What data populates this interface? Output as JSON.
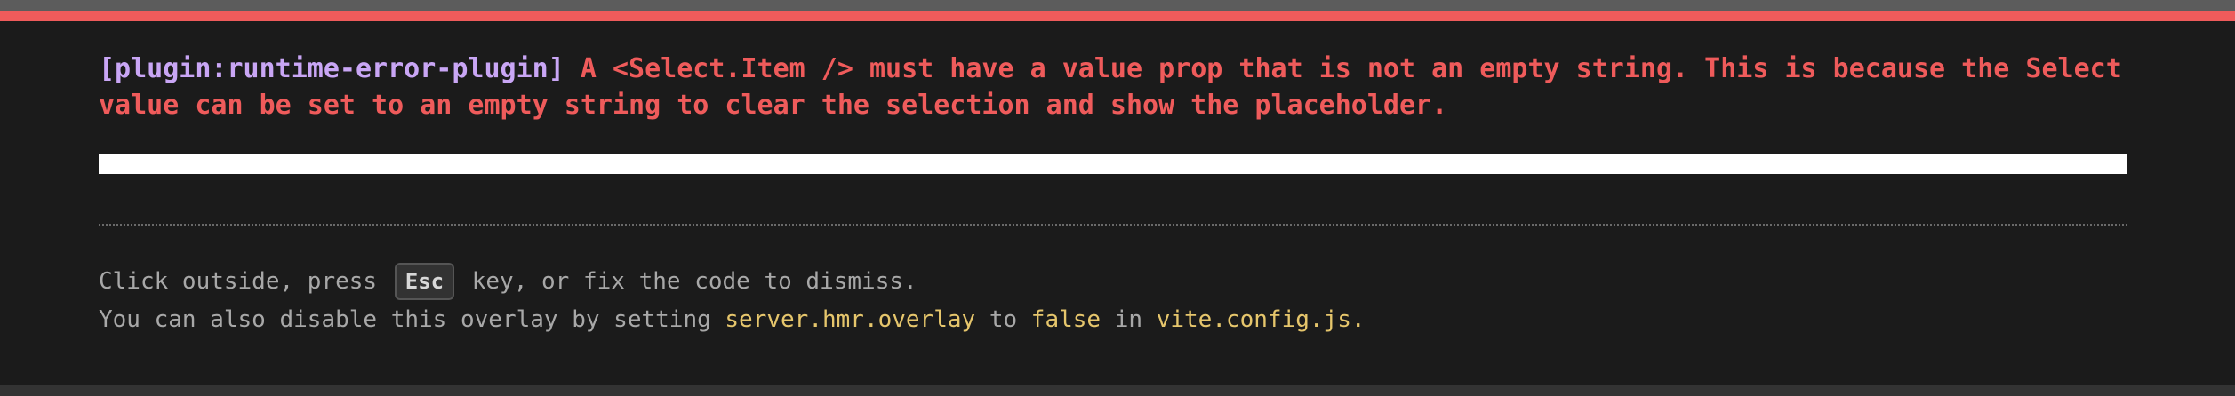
{
  "error": {
    "plugin": "[plugin:runtime-error-plugin]",
    "message": "A <Select.Item /> must have a value prop that is not an empty string. This is because the Select value can be set to an empty string to clear the selection and show the placeholder."
  },
  "tip_line1": {
    "before": "Click outside, press",
    "key": "Esc",
    "after": "key, or fix the code to dismiss."
  },
  "tip_line2": {
    "text1": "You can also disable this overlay by setting ",
    "setting": "server.hmr.overlay",
    "text2": " to ",
    "value": "false",
    "text3": " in ",
    "file": "vite.config.js",
    "text4": "."
  },
  "colors": {
    "error": "#ef5b5b",
    "plugin": "#c9a6f5",
    "code": "#e6c66c",
    "background": "#1b1b1b"
  }
}
